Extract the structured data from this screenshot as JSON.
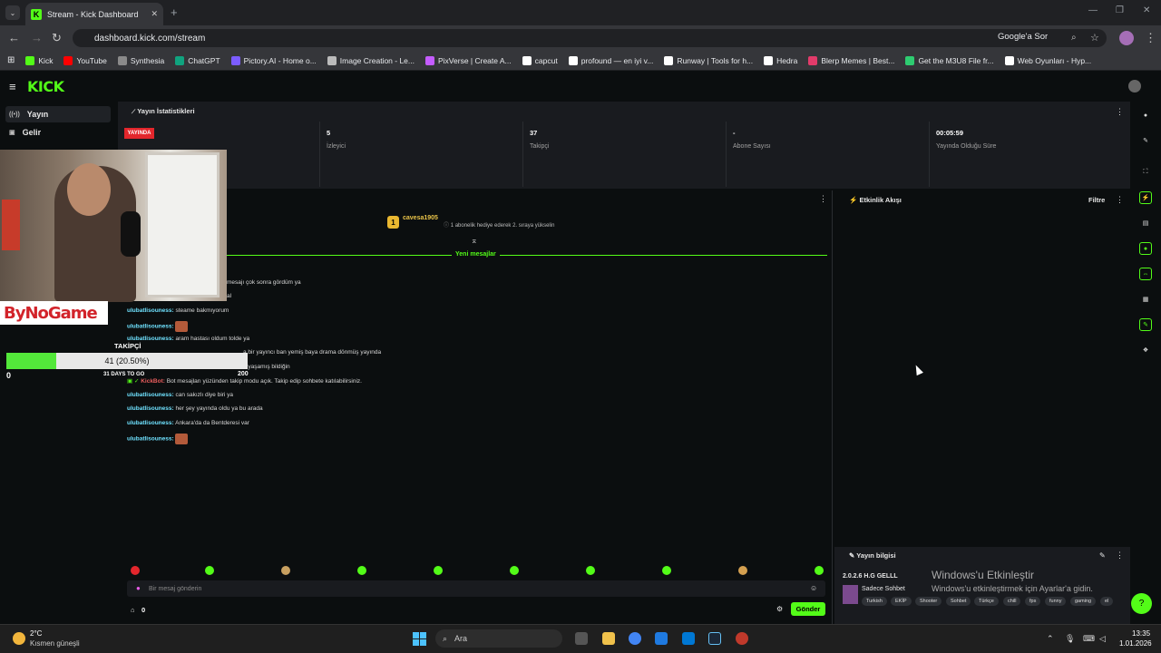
{
  "browser": {
    "tab_title": "Stream - Kick Dashboard",
    "url": "dashboard.kick.com/stream",
    "google_sor": "Google'a Sor",
    "bookmarks": [
      "Kick",
      "YouTube",
      "Synthesia",
      "ChatGPT",
      "Pictory.AI - Home o...",
      "Image Creation - Le...",
      "PixVerse | Create A...",
      "capcut",
      "profound — en iyi v...",
      "Runway | Tools for h...",
      "Hedra",
      "Blerp Memes | Best...",
      "Get the M3U8 File fr...",
      "Web Oyunları - Hyp..."
    ],
    "bookmark_colors": [
      "#53fc18",
      "#ff0000",
      "#8a8a8a",
      "#10a37f",
      "#7b5cff",
      "#bbbbbb",
      "#c45cff",
      "#ffffff",
      "#ffffff",
      "#ffffff",
      "#ffffff",
      "#e23b6a",
      "#2ecc71",
      "#ffffff"
    ]
  },
  "kick": {
    "logo": "KICK",
    "sidebar": {
      "items": [
        {
          "label": "Yayın",
          "icon": "broadcast-icon"
        },
        {
          "label": "Gelir",
          "icon": "revenue-icon"
        }
      ]
    },
    "stats": {
      "title": "Yayın İstatistikleri",
      "live_badge": "YAYINDA",
      "viewers_value": "5",
      "viewers_label": "İzleyici",
      "followers_value": "37",
      "followers_label": "Takipçi",
      "subs_value": "-",
      "subs_label": "Abone Sayısı",
      "uptime_value": "00:05:59",
      "uptime_label": "Yayında Olduğu Süre"
    },
    "chat": {
      "pinned_user": "cavesa1905",
      "pinned_rank": "1",
      "pinned_message": "1 abonelik hediye ederek 2. sıraya yükselin",
      "new_messages_label": "Yeni mesajlar",
      "lines": [
        {
          "user": "",
          "text": "mesajı çok sonra gördüm ya",
          "emote": false
        },
        {
          "user": "",
          "text": "al",
          "emote": false
        },
        {
          "user": "ulubatlisouness:",
          "text": "steame bakmıyorum",
          "emote": false
        },
        {
          "user": "ulubatlisouness:",
          "text": "",
          "emote": true
        },
        {
          "user": "ulubatlisouness:",
          "text": "aram hastası oldum tolde ya",
          "emote": false
        },
        {
          "user": "",
          "text": "a bir yayıncı ban yemiş baya drama dönmüş yayında",
          "emote": false
        },
        {
          "user": "",
          "text": "e yaşamış bildiğin",
          "emote": false
        },
        {
          "user": "KickBot:",
          "text": "Bot mesajları yüzünden takip modu açık. Takip edip sohbete katılabilirsiniz.",
          "emote": false,
          "bot": true
        },
        {
          "user": "ulubatlisouness:",
          "text": "can sakızlı diye biri ya",
          "emote": false
        },
        {
          "user": "ulubatlisouness:",
          "text": "her şey yayında oldu ya bu arada",
          "emote": false
        },
        {
          "user": "ulubatlisouness:",
          "text": "Ankara'da da Bentderesi var",
          "emote": false
        },
        {
          "user": "ulubatlisouness:",
          "text": "",
          "emote": true
        }
      ],
      "input_placeholder": "Bir mesaj gönderin",
      "send_label": "Gönder",
      "chatters_count": "0"
    },
    "feed": {
      "title": "Etkinlik Akışı",
      "filter_label": "Filtre"
    },
    "stream_info": {
      "title": "Yayın bilgisi",
      "stream_title": "2.0.2.6 H.G GELLL",
      "category": "Sadece Sohbet",
      "tags": [
        "Turkish",
        "EKİP",
        "Shooter",
        "Sohbet",
        "Türkçe",
        "chill",
        "fps",
        "funny",
        "gaming",
        "el"
      ]
    }
  },
  "overlay": {
    "brand": "ByNoGame",
    "goal_label": "TAKİPÇİ",
    "goal_text": "41 (20.50%)",
    "goal_fraction": 0.205,
    "goal_min": "0",
    "goal_max": "200",
    "goal_days": "31 DAYS TO GO"
  },
  "windows_activation": {
    "line1": "Windows'u Etkinleştir",
    "line2": "Windows'u etkinleştirmek için Ayarlar'a gidin."
  },
  "taskbar": {
    "temp": "2°C",
    "weather": "Kısmen güneşli",
    "search_placeholder": "Ara",
    "time": "13:35",
    "date": "1.01.2026"
  }
}
